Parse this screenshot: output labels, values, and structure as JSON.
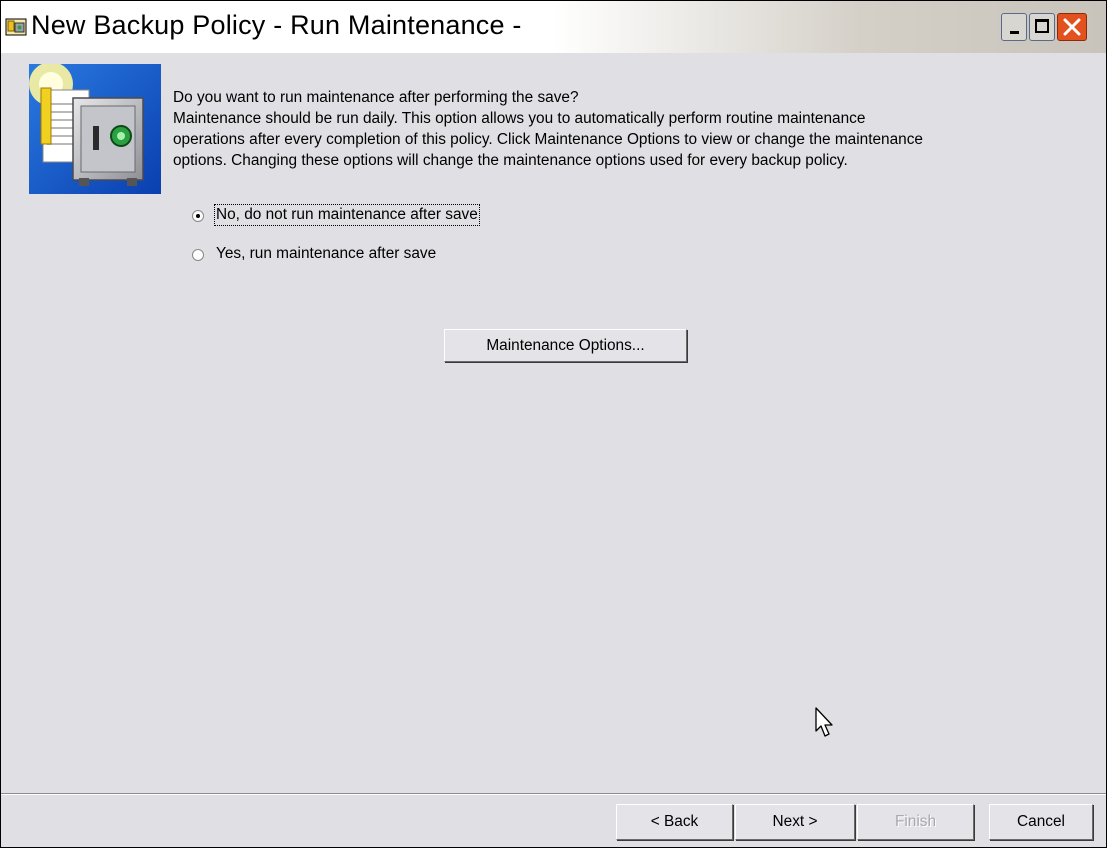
{
  "window": {
    "title": "New Backup Policy - Run Maintenance -",
    "controls": {
      "minimize_icon": "minimize-icon",
      "maximize_icon": "maximize-icon",
      "close_icon": "close-icon"
    }
  },
  "content": {
    "question": "Do you want to run maintenance after performing the save?",
    "description_lines": [
      "Maintenance should be run daily.  This option allows you to automatically perform routine maintenance",
      "operations after every completion of this policy.  Click Maintenance Options to view or change the maintenance",
      "options.  Changing these options will change the maintenance options used for every backup policy."
    ],
    "radio_options": [
      {
        "label": "No, do not run maintenance after save",
        "selected": true
      },
      {
        "label": "Yes, run maintenance after save",
        "selected": false
      }
    ],
    "maintenance_options_label": "Maintenance Options..."
  },
  "footer": {
    "back_label": "< Back",
    "next_label": "Next >",
    "finish_label": "Finish",
    "cancel_label": "Cancel"
  },
  "colors": {
    "dialog_background": "#e0dfe3",
    "close_button": "#e3521e",
    "disabled_text": "#a8a8ad"
  }
}
